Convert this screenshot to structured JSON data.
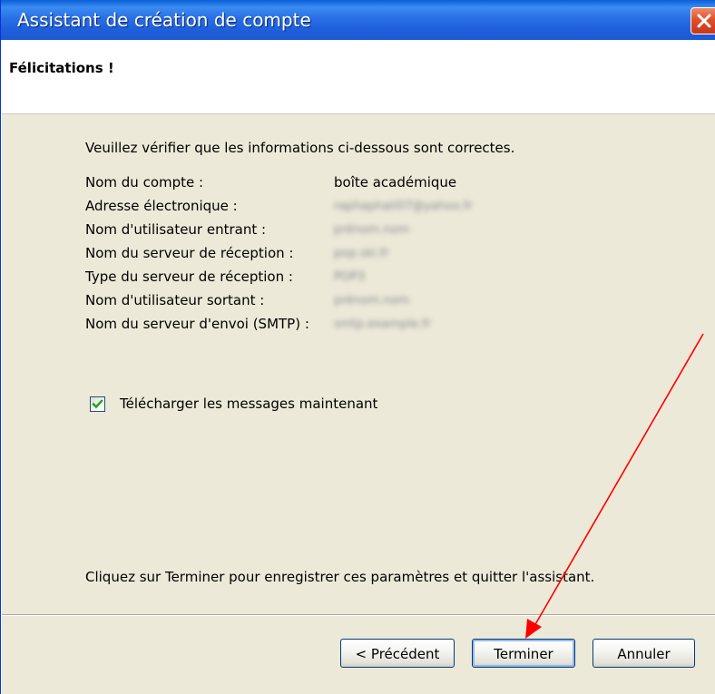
{
  "window": {
    "title": "Assistant de création de compte",
    "close_icon": "close-icon"
  },
  "header": {
    "title": "Félicitations !"
  },
  "content": {
    "intro": "Veuillez vérifier que les informations ci-dessous sont correctes.",
    "rows": [
      {
        "label": "Nom du compte :",
        "value": "boîte académique",
        "blurred": false
      },
      {
        "label": "Adresse électronique :",
        "value": "raphaphali07@yahoo.fr",
        "blurred": true
      },
      {
        "label": "Nom d'utilisateur entrant :",
        "value": "prénom.nom",
        "blurred": true
      },
      {
        "label": "Nom du serveur de réception :",
        "value": "pop.ski.fr",
        "blurred": true
      },
      {
        "label": "Type du serveur de réception :",
        "value": "POP3",
        "blurred": true
      },
      {
        "label": "Nom d'utilisateur sortant :",
        "value": "prénom.nom",
        "blurred": true
      },
      {
        "label": "Nom du serveur d'envoi (SMTP) :",
        "value": "smtp.example.fr",
        "blurred": true
      }
    ],
    "download_checkbox": {
      "label": "Télécharger les messages maintenant",
      "checked": true
    },
    "footer_note": "Cliquez sur Terminer pour enregistrer ces paramètres et quitter l'assistant."
  },
  "buttons": {
    "previous": "< Précédent",
    "finish": "Terminer",
    "cancel": "Annuler"
  },
  "colors": {
    "titlebar": "#1e5fdc",
    "panel": "#ece9d8",
    "annotation_arrow": "#ff0000"
  }
}
